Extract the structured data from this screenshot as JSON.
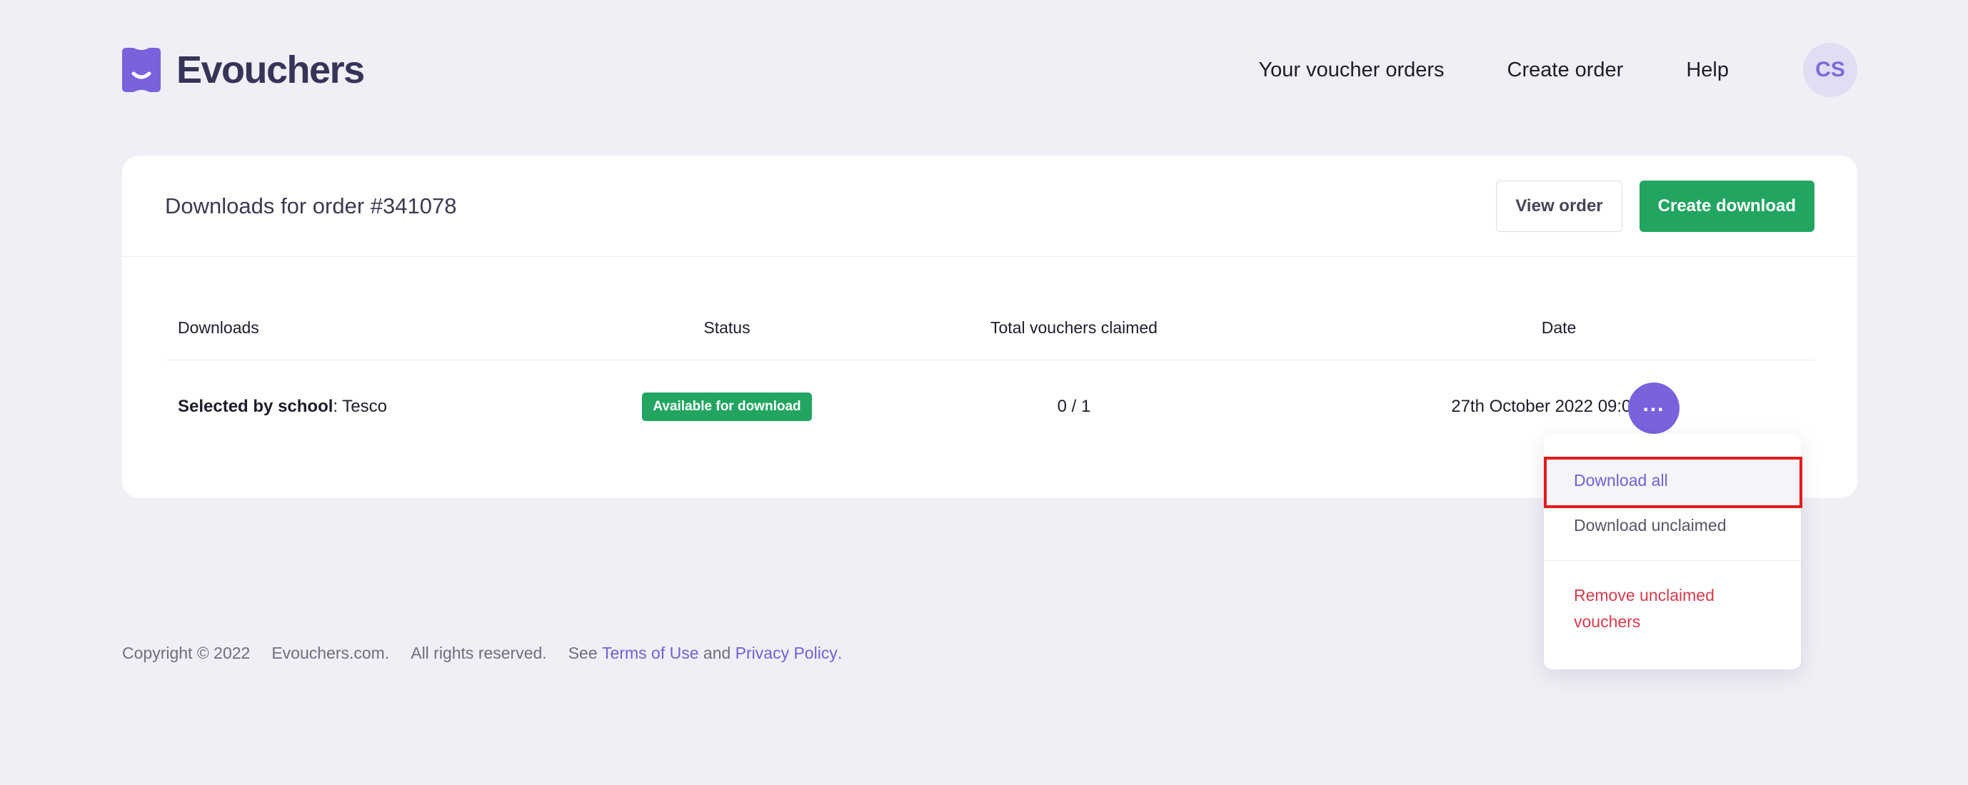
{
  "brand": {
    "name": "Evouchers",
    "logo_color": "#7a62dd"
  },
  "nav": {
    "orders": "Your voucher orders",
    "create": "Create order",
    "help": "Help",
    "avatar_initials": "CS"
  },
  "card": {
    "title": "Downloads for order #341078",
    "view_order": "View order",
    "create_download": "Create download"
  },
  "table": {
    "headers": [
      "Downloads",
      "Status",
      "Total vouchers claimed",
      "Date"
    ],
    "rows": [
      {
        "label_bold": "Selected by school",
        "label_rest": ": Tesco",
        "status": "Available for download",
        "claimed": "0 / 1",
        "date": "27th October 2022 09:04AM"
      }
    ]
  },
  "menu": {
    "download_all": "Download all",
    "download_unclaimed": "Download unclaimed",
    "remove_unclaimed": "Remove unclaimed vouchers"
  },
  "footer": {
    "copyright": "Copyright © 2022",
    "site": "Evouchers.com.",
    "rights": "All rights reserved.",
    "see": "See",
    "terms": "Terms of Use",
    "and": "and",
    "privacy": "Privacy Policy",
    "period": "."
  },
  "colors": {
    "accent": "#7a62dd",
    "success": "#22a561",
    "danger": "#d43b4c",
    "highlight": "#e41b1b"
  }
}
